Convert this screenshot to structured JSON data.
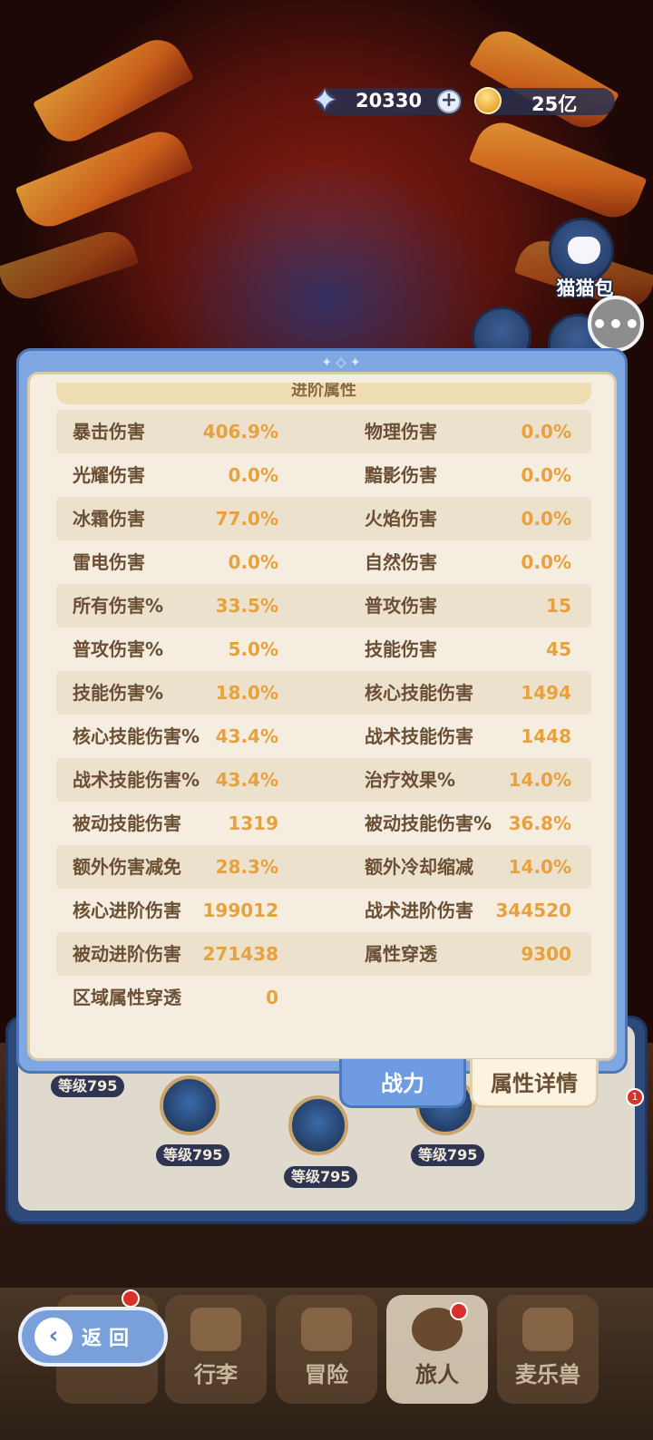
{
  "currency": {
    "gems": {
      "icon": "star-gem-icon",
      "value": "20330"
    },
    "gold": {
      "icon": "gold-coin-icon",
      "value": "25亿"
    }
  },
  "side": {
    "cat_bag_label": "猫猫包"
  },
  "panel": {
    "header": "进阶属性",
    "rows": [
      {
        "l_label": "暴击伤害",
        "l_value": "406.9%",
        "r_label": "物理伤害",
        "r_value": "0.0%"
      },
      {
        "l_label": "光耀伤害",
        "l_value": "0.0%",
        "r_label": "黯影伤害",
        "r_value": "0.0%"
      },
      {
        "l_label": "冰霜伤害",
        "l_value": "77.0%",
        "r_label": "火焰伤害",
        "r_value": "0.0%"
      },
      {
        "l_label": "雷电伤害",
        "l_value": "0.0%",
        "r_label": "自然伤害",
        "r_value": "0.0%"
      },
      {
        "l_label": "所有伤害%",
        "l_value": "33.5%",
        "r_label": "普攻伤害",
        "r_value": "15"
      },
      {
        "l_label": "普攻伤害%",
        "l_value": "5.0%",
        "r_label": "技能伤害",
        "r_value": "45"
      },
      {
        "l_label": "技能伤害%",
        "l_value": "18.0%",
        "r_label": "核心技能伤害",
        "r_value": "1494"
      },
      {
        "l_label": "核心技能伤害%",
        "l_value": "43.4%",
        "r_label": "战术技能伤害",
        "r_value": "1448"
      },
      {
        "l_label": "战术技能伤害%",
        "l_value": "43.4%",
        "r_label": "治疗效果%",
        "r_value": "14.0%"
      },
      {
        "l_label": "被动技能伤害",
        "l_value": "1319",
        "r_label": "被动技能伤害%",
        "r_value": "36.8%"
      },
      {
        "l_label": "额外伤害减免",
        "l_value": "28.3%",
        "r_label": "额外冷却缩减",
        "r_value": "14.0%"
      },
      {
        "l_label": "核心进阶伤害",
        "l_value": "199012",
        "r_label": "战术进阶伤害",
        "r_value": "344520"
      },
      {
        "l_label": "被动进阶伤害",
        "l_value": "271438",
        "r_label": "属性穿透",
        "r_value": "9300"
      },
      {
        "l_label": "区域属性穿透",
        "l_value": "0",
        "r_label": "",
        "r_value": ""
      }
    ]
  },
  "tabs": {
    "power": "战力",
    "detail": "属性详情"
  },
  "levels": {
    "a": "等级795",
    "b": "等级795",
    "c": "等级795",
    "d": "等级795"
  },
  "badges": {
    "friend_count": "1"
  },
  "nav": {
    "back": "返回",
    "bag": "行李",
    "adventure": "冒险",
    "traveler": "旅人",
    "pet": "麦乐兽"
  },
  "colors": {
    "panel_blue": "#7fa7e2",
    "value_orange": "#e8a13c",
    "label_brown": "#6b4f35",
    "row_shade": "#ebe1cc"
  }
}
